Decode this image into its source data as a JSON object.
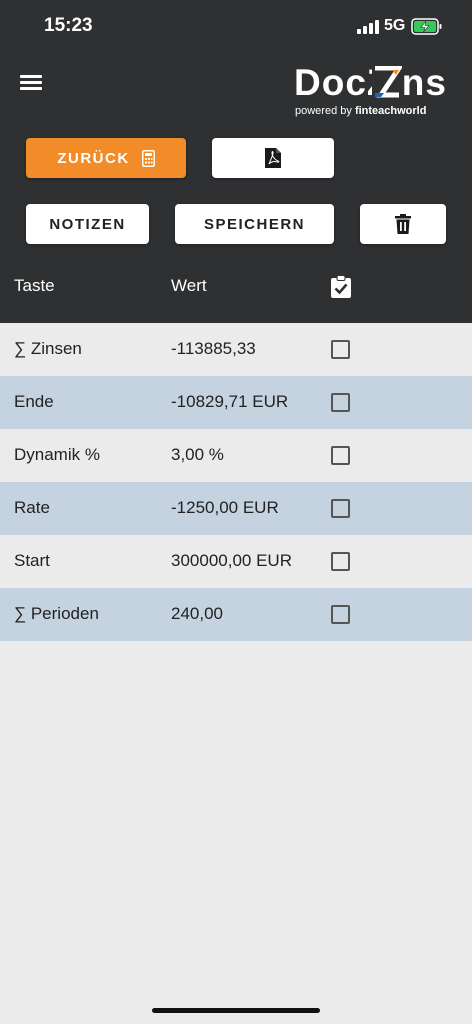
{
  "status_bar": {
    "time": "15:23",
    "network": "5G"
  },
  "logo": {
    "brand": "DocZins",
    "sub_prefix": "powered by",
    "sub_brand": "finteachworld"
  },
  "toolbar": {
    "back_label": "ZURÜCK",
    "notes_label": "NOTIZEN",
    "save_label": "SPEICHERN"
  },
  "table": {
    "headers": {
      "key": "Taste",
      "value": "Wert"
    },
    "rows": [
      {
        "key": "∑ Zinsen",
        "value": "-113885,33"
      },
      {
        "key": "Ende",
        "value": "-10829,71 EUR"
      },
      {
        "key": "Dynamik %",
        "value": "3,00 %"
      },
      {
        "key": "Rate",
        "value": "-1250,00 EUR"
      },
      {
        "key": "Start",
        "value": "300000,00 EUR"
      },
      {
        "key": "∑ Perioden",
        "value": "240,00"
      }
    ]
  },
  "colors": {
    "header_bg": "#2f3032",
    "accent_orange": "#f28c28",
    "row_alt": "#c5d3e0",
    "row_base": "#ebebeb",
    "logo_orange": "#f28c28",
    "logo_blue": "#1e63b5"
  },
  "icons": [
    "hamburger-menu-icon",
    "calculator-icon",
    "pdf-icon",
    "trash-icon",
    "clipboard-check-icon",
    "checkbox-icon"
  ]
}
